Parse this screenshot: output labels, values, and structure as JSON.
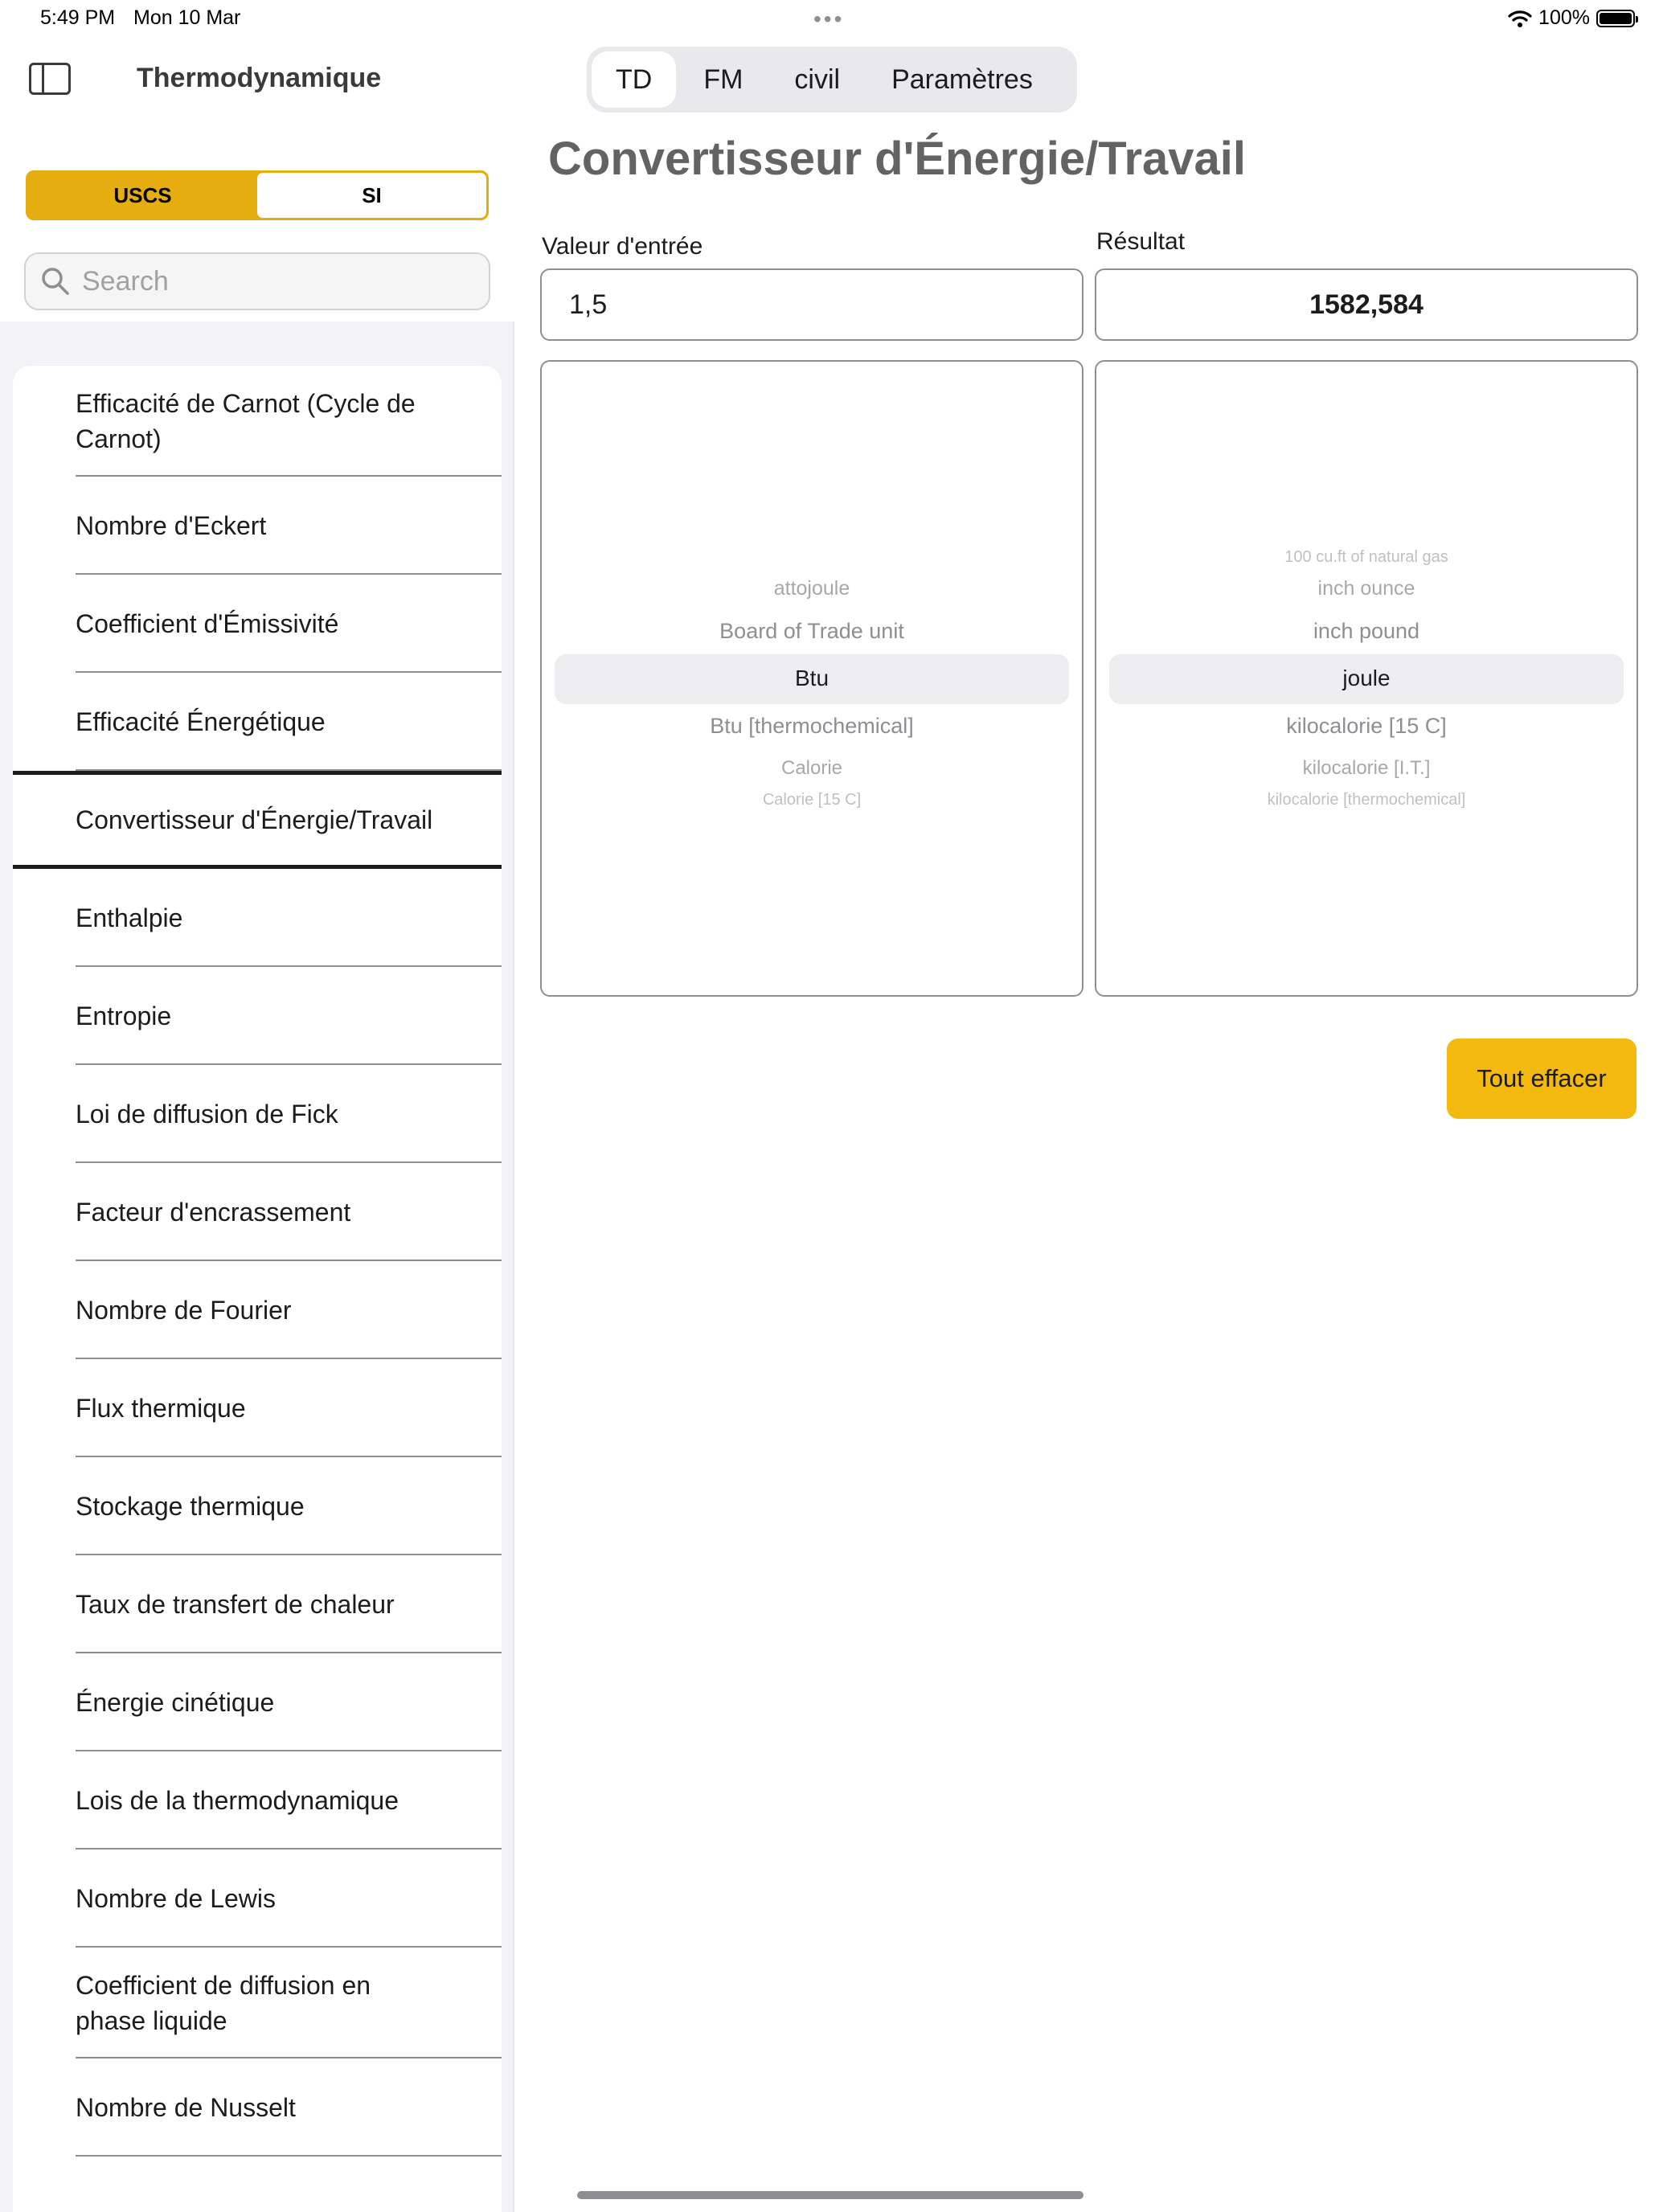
{
  "status_bar": {
    "time": "5:49 PM",
    "date": "Mon 10 Mar",
    "battery": "100%",
    "wifi_icon": "wifi-icon",
    "battery_icon": "battery-full-icon"
  },
  "top_dots": "•••",
  "sidebar": {
    "title": "Thermodynamique",
    "unit_toggle": {
      "options": [
        "USCS",
        "SI"
      ],
      "selected": "SI"
    },
    "search": {
      "placeholder": "Search",
      "value": ""
    },
    "items": [
      {
        "label": "Efficacité de Carnot (Cycle de Carnot)"
      },
      {
        "label": "Nombre d'Eckert"
      },
      {
        "label": "Coefficient d'Émissivité"
      },
      {
        "label": "Efficacité Énergétique"
      },
      {
        "label": "Convertisseur d'Énergie/Travail",
        "selected": true
      },
      {
        "label": "Enthalpie"
      },
      {
        "label": "Entropie"
      },
      {
        "label": "Loi de diffusion de Fick"
      },
      {
        "label": "Facteur d'encrassement"
      },
      {
        "label": "Nombre de Fourier"
      },
      {
        "label": "Flux thermique"
      },
      {
        "label": "Stockage thermique"
      },
      {
        "label": "Taux de transfert de chaleur"
      },
      {
        "label": "Énergie cinétique"
      },
      {
        "label": "Lois de la thermodynamique"
      },
      {
        "label": "Nombre de Lewis"
      },
      {
        "label": "Coefficient de diffusion en phase liquide"
      },
      {
        "label": "Nombre de Nusselt"
      }
    ]
  },
  "tabs": [
    "TD",
    "FM",
    "civil",
    "Paramètres"
  ],
  "active_tab": "TD",
  "main": {
    "title": "Convertisseur d'Énergie/Travail",
    "input_label": "Valeur d'entrée",
    "input_value": "1,5",
    "result_label": "Résultat",
    "result_value": "1582,584",
    "from_picker": {
      "above": [
        "attojoule",
        "Board of Trade unit"
      ],
      "selected": "Btu",
      "below": [
        "Btu [thermochemical]",
        "Calorie",
        "Calorie [15 C]"
      ]
    },
    "to_picker": {
      "above": [
        "100 cu.ft of natural gas",
        "inch ounce",
        "inch pound"
      ],
      "selected": "joule",
      "below": [
        "kilocalorie [15 C]",
        "kilocalorie [I.T.]",
        "kilocalorie [thermochemical]"
      ]
    },
    "clear_button": "Tout effacer"
  },
  "colors": {
    "accent": "#f4b90f",
    "toggle_bg": "#e5ad10",
    "sidebar_bg": "#f2f2f7",
    "title_gray": "#636366"
  }
}
